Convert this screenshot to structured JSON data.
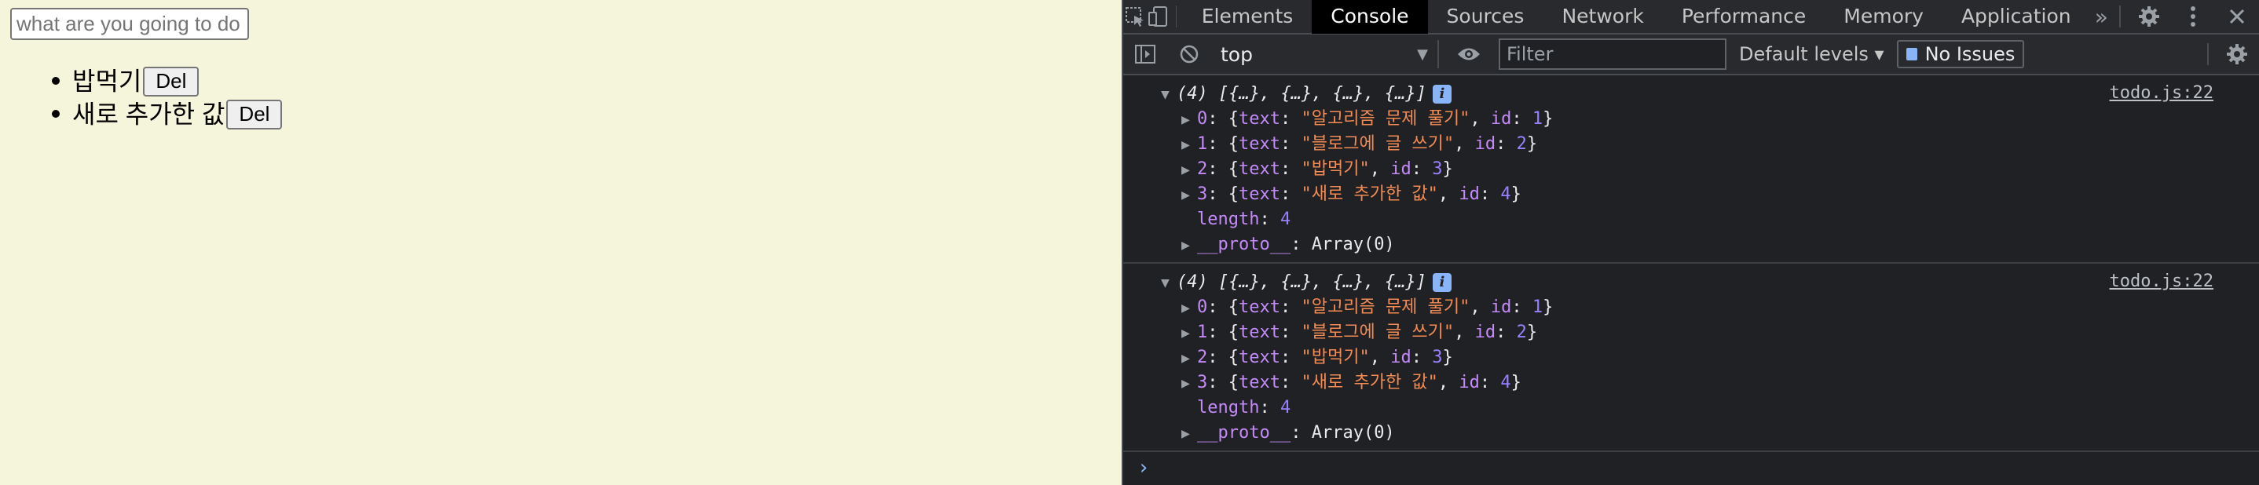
{
  "page": {
    "input_placeholder": "what are you going to do",
    "todos": [
      {
        "text": "밥먹기",
        "button": "Del"
      },
      {
        "text": "새로 추가한 값",
        "button": "Del"
      }
    ]
  },
  "devtools": {
    "tabs": [
      "Elements",
      "Console",
      "Sources",
      "Network",
      "Performance",
      "Memory",
      "Application"
    ],
    "active_tab": "Console",
    "more_tabs": "»",
    "toolbar": {
      "context": "top",
      "filter_placeholder": "Filter",
      "levels": "Default levels ▾",
      "issues": "No Issues"
    },
    "messages": [
      {
        "header": "(4) [{…}, {…}, {…}, {…}]",
        "source": "todo.js:22",
        "items": [
          {
            "index": "0",
            "text": "알고리즘 문제 풀기",
            "id": "1"
          },
          {
            "index": "1",
            "text": "블로그에 글 쓰기",
            "id": "2"
          },
          {
            "index": "2",
            "text": "밥먹기",
            "id": "3"
          },
          {
            "index": "3",
            "text": "새로 추가한 값",
            "id": "4"
          }
        ],
        "length_key": "length",
        "length_value": "4",
        "proto_key": "__proto__",
        "proto_value": "Array(0)"
      },
      {
        "header": "(4) [{…}, {…}, {…}, {…}]",
        "source": "todo.js:22",
        "items": [
          {
            "index": "0",
            "text": "알고리즘 문제 풀기",
            "id": "1"
          },
          {
            "index": "1",
            "text": "블로그에 글 쓰기",
            "id": "2"
          },
          {
            "index": "2",
            "text": "밥먹기",
            "id": "3"
          },
          {
            "index": "3",
            "text": "새로 추가한 값",
            "id": "4"
          }
        ],
        "length_key": "length",
        "length_value": "4",
        "proto_key": "__proto__",
        "proto_value": "Array(0)"
      }
    ],
    "prompt": "›"
  }
}
